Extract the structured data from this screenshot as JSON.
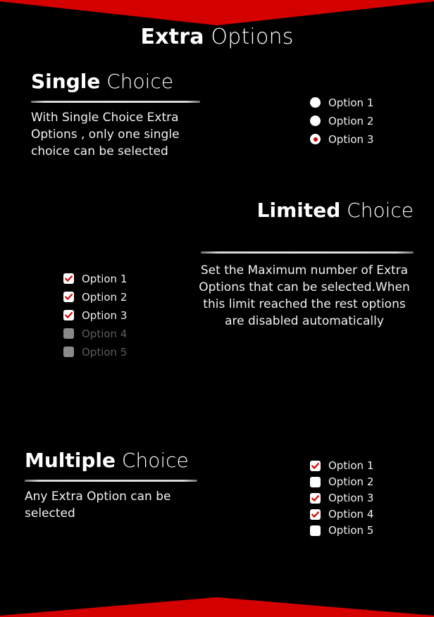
{
  "theme": {
    "background": "#000000",
    "accent_red": "#d40000",
    "text": "#ffffff",
    "disabled_text": "#5d5d5d",
    "rule": "#e2e2e2"
  },
  "header": {
    "title_bold": "Extra",
    "title_light": " Options",
    "top_shape": "chevron-down",
    "bottom_shape": "chevron-up"
  },
  "sections": {
    "single": {
      "title_bold": "Single",
      "title_light": " Choice",
      "body": "With Single Choice Extra Options ,  only one single choice can be selected",
      "options": [
        {
          "label": "Option 1",
          "checked": false,
          "disabled": false
        },
        {
          "label": "Option 2",
          "checked": false,
          "disabled": false
        },
        {
          "label": "Option 3",
          "checked": true,
          "disabled": false
        }
      ]
    },
    "limited": {
      "title_bold": "Limited",
      "title_light": " Choice",
      "body": "Set the Maximum number of Extra Options that can be selected.When this limit reached the rest options are disabled automatically",
      "options": [
        {
          "label": "Option 1",
          "checked": true,
          "disabled": false
        },
        {
          "label": "Option 2",
          "checked": true,
          "disabled": false
        },
        {
          "label": "Option 3",
          "checked": true,
          "disabled": false
        },
        {
          "label": "Option 4",
          "checked": false,
          "disabled": true
        },
        {
          "label": "Option 5",
          "checked": false,
          "disabled": true
        }
      ]
    },
    "multiple": {
      "title_bold": "Multiple",
      "title_light": " Choice",
      "body": "Any Extra Option can be selected",
      "options": [
        {
          "label": "Option 1",
          "checked": true,
          "disabled": false
        },
        {
          "label": "Option 2",
          "checked": false,
          "disabled": false
        },
        {
          "label": "Option 3",
          "checked": true,
          "disabled": false
        },
        {
          "label": "Option 4",
          "checked": true,
          "disabled": false
        },
        {
          "label": "Option 5",
          "checked": false,
          "disabled": false
        }
      ]
    }
  }
}
